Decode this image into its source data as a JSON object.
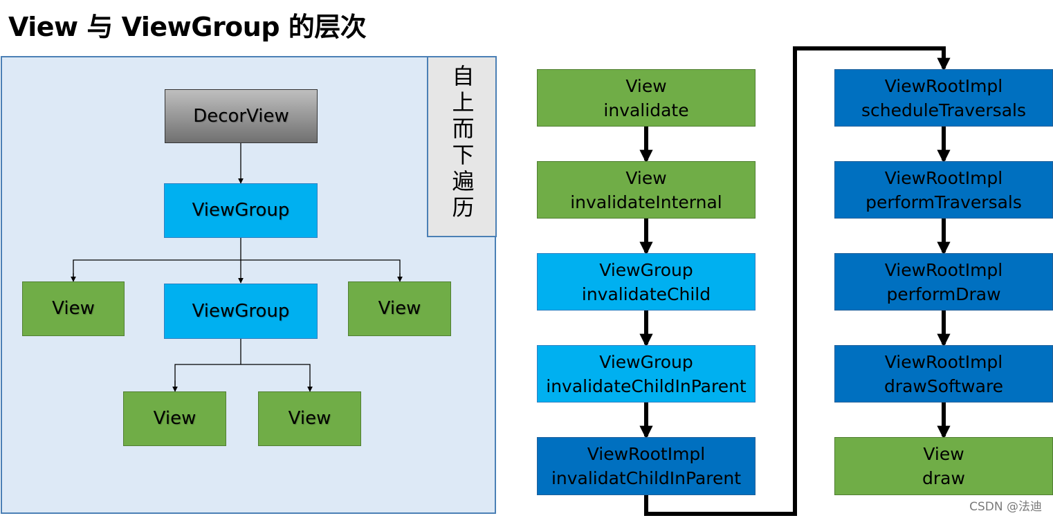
{
  "title": "View 与 ViewGroup 的层次",
  "sidebar": "自上而下遍历",
  "tree": {
    "root": "DecorView",
    "level1": "ViewGroup",
    "level2_left": "View",
    "level2_middle": "ViewGroup",
    "level2_right": "View",
    "level3_left": "View",
    "level3_right": "View"
  },
  "flow": [
    {
      "class": "View",
      "method": "invalidate"
    },
    {
      "class": "View",
      "method": "invalidateInternal"
    },
    {
      "class": "ViewGroup",
      "method": "invalidateChild"
    },
    {
      "class": "ViewGroup",
      "method": "invalidateChildInParent"
    },
    {
      "class": "ViewRootImpl",
      "method": "invalidatChildInParent"
    },
    {
      "class": "ViewRootImpl",
      "method": "scheduleTraversals"
    },
    {
      "class": "ViewRootImpl",
      "method": "performTraversals"
    },
    {
      "class": "ViewRootImpl",
      "method": "performDraw"
    },
    {
      "class": "ViewRootImpl",
      "method": "drawSoftware"
    },
    {
      "class": "View",
      "method": "draw"
    }
  ],
  "watermark": "CSDN @法迪",
  "colors": {
    "view": "#70ad47",
    "viewgroup": "#00b0f0",
    "viewrootimpl": "#0070c0",
    "decorview": "#8c8c8c",
    "panel": "#dde9f6"
  }
}
